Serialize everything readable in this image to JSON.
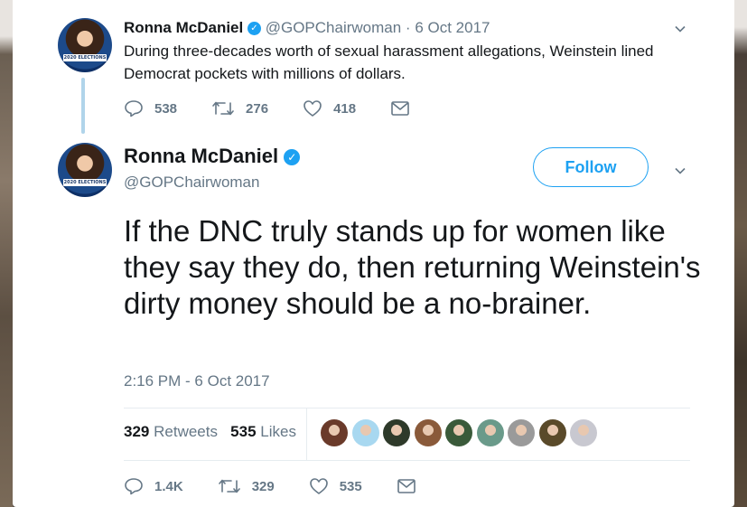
{
  "tweet1": {
    "name": "Ronna McDaniel",
    "handle": "@GOPChairwoman",
    "separator": "·",
    "date": "6 Oct 2017",
    "text": "During three-decades worth of sexual harassment allegations, Weinstein lined Democrat pockets with millions of dollars.",
    "replies": "538",
    "retweets": "276",
    "likes": "418"
  },
  "tweet2": {
    "name": "Ronna McDaniel",
    "handle": "@GOPChairwoman",
    "follow_label": "Follow",
    "text": "If the DNC truly stands up for women like they say they do, then returning Weinstein's dirty money should be a no-brainer.",
    "timestamp": "2:16 PM - 6 Oct 2017",
    "retweet_count": "329",
    "retweet_label": "Retweets",
    "like_count": "535",
    "like_label": "Likes",
    "replies": "1.4K",
    "retweets": "329",
    "likes": "535"
  },
  "avatar_caption": "2020 ELECTIONS",
  "icons": {
    "verified": "verified-badge-icon",
    "menu": "chevron-down-icon",
    "reply": "reply-icon",
    "retweet": "retweet-icon",
    "like": "heart-icon",
    "dm": "envelope-icon"
  },
  "colors": {
    "accent": "#1da1f2",
    "text": "#14171a",
    "muted": "#657786",
    "thread_line": "#b0d4ea"
  },
  "likers": [
    {
      "color": "#6a3a2a"
    },
    {
      "color": "#a8d8f0"
    },
    {
      "color": "#2e3a2a"
    },
    {
      "color": "#8a5a3a"
    },
    {
      "color": "#3a5a3a"
    },
    {
      "color": "#6a9a8a"
    },
    {
      "color": "#9a9a9a"
    },
    {
      "color": "#5a4a2a"
    },
    {
      "color": "#c8c8d0"
    }
  ]
}
